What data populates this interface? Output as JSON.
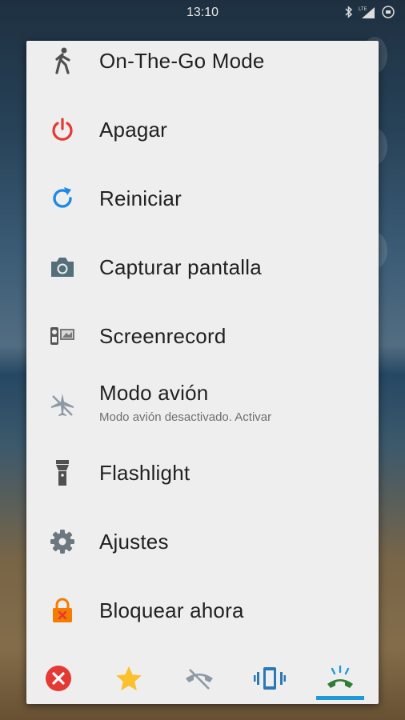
{
  "status_bar": {
    "time": "13:10",
    "network_type": "LTE"
  },
  "menu": {
    "items": [
      {
        "label": "On-The-Go Mode",
        "icon": "walking-person-icon"
      },
      {
        "label": "Apagar",
        "icon": "power-icon"
      },
      {
        "label": "Reiniciar",
        "icon": "restart-icon"
      },
      {
        "label": "Capturar pantalla",
        "icon": "camera-icon"
      },
      {
        "label": "Screenrecord",
        "icon": "screenrecord-icon"
      },
      {
        "label": "Modo avión",
        "sublabel": "Modo avión desactivado. Activar",
        "icon": "airplane-icon"
      },
      {
        "label": "Flashlight",
        "icon": "flashlight-icon"
      },
      {
        "label": "Ajustes",
        "icon": "gear-icon"
      },
      {
        "label": "Bloquear ahora",
        "icon": "lock-icon"
      }
    ]
  },
  "sound_modes": {
    "buttons": [
      "silent",
      "priority",
      "mute-ringer",
      "vibrate",
      "sound"
    ],
    "active": "sound"
  },
  "colors": {
    "power": "#e53935",
    "restart": "#1e88e5",
    "camera": "#546e7a",
    "lock": "#f57c00",
    "accent": "#1e9ad6",
    "dialog_bg": "#eeeeee"
  }
}
